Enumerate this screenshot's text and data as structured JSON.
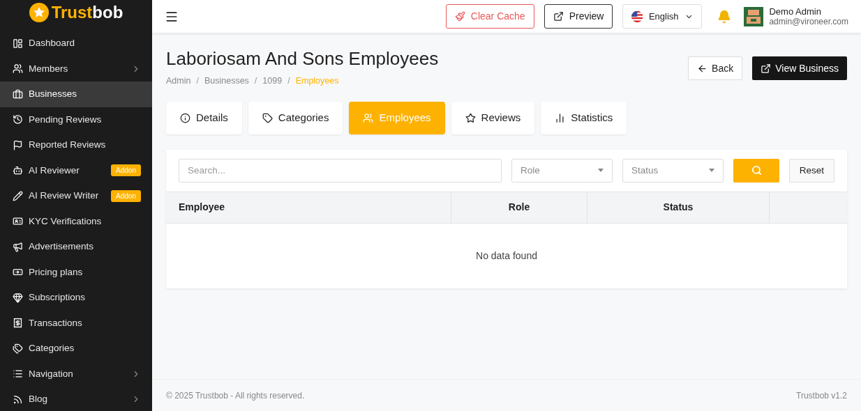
{
  "brand": {
    "first": "Trust",
    "second": "bob"
  },
  "sidebar": {
    "items": [
      {
        "label": "Dashboard",
        "selected": false
      },
      {
        "label": "Members",
        "selected": false,
        "chevron": true
      },
      {
        "label": "Businesses",
        "selected": true
      },
      {
        "label": "Pending Reviews",
        "selected": false
      },
      {
        "label": "Reported Reviews",
        "selected": false
      },
      {
        "label": "AI Reviewer",
        "selected": false,
        "badge": "Addon"
      },
      {
        "label": "AI Review Writer",
        "selected": false,
        "badge": "Addon"
      },
      {
        "label": "KYC Verifications",
        "selected": false
      },
      {
        "label": "Advertisements",
        "selected": false
      },
      {
        "label": "Pricing plans",
        "selected": false
      },
      {
        "label": "Subscriptions",
        "selected": false
      },
      {
        "label": "Transactions",
        "selected": false
      },
      {
        "label": "Categories",
        "selected": false
      },
      {
        "label": "Navigation",
        "selected": false,
        "chevron": true
      },
      {
        "label": "Blog",
        "selected": false,
        "chevron": true
      }
    ]
  },
  "header": {
    "clear_cache": "Clear Cache",
    "preview": "Preview",
    "language": "English",
    "user": {
      "name": "Demo Admin",
      "email": "admin@vironeer.com"
    }
  },
  "page": {
    "title": "Laboriosam And Sons Employees",
    "breadcrumb": [
      {
        "label": "Admin",
        "current": false
      },
      {
        "label": "Businesses",
        "current": false
      },
      {
        "label": "1099",
        "current": false
      },
      {
        "label": "Employees",
        "current": true
      }
    ],
    "breadcrumb_separator": "/",
    "back": "Back",
    "view_business": "View Business"
  },
  "tabs": [
    {
      "label": "Details",
      "selected": false
    },
    {
      "label": "Categories",
      "selected": false
    },
    {
      "label": "Employees",
      "selected": true
    },
    {
      "label": "Reviews",
      "selected": false
    },
    {
      "label": "Statistics",
      "selected": false
    }
  ],
  "filters": {
    "search": {
      "placeholder": "Search..."
    },
    "role": {
      "placeholder": "Role"
    },
    "status": {
      "placeholder": "Status"
    },
    "reset": "Reset"
  },
  "table": {
    "columns": [
      "Employee",
      "Role",
      "Status"
    ],
    "empty": "No data found"
  },
  "footer": {
    "copyright": "© 2025 Trustbob - All rights reserved.",
    "version": "Trustbob v1.2"
  }
}
